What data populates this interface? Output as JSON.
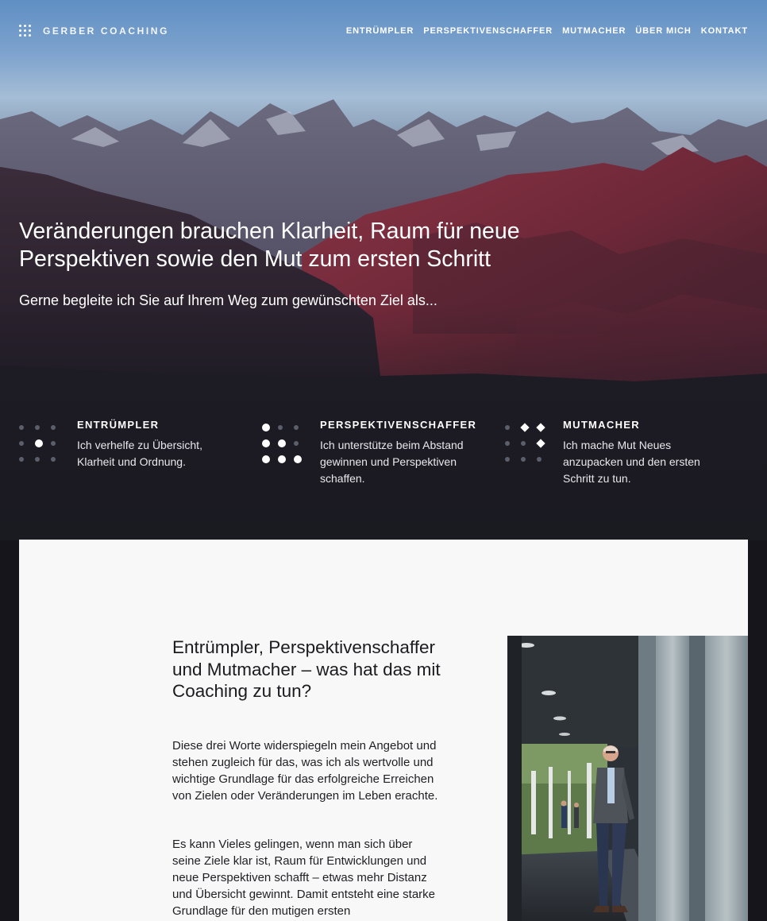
{
  "header": {
    "logo_text": "GERBER COACHING",
    "nav": [
      "ENTRÜMPLER",
      "PERSPEKTIVENSCHAFFER",
      "MUTMACHER",
      "ÜBER MICH",
      "KONTAKT"
    ]
  },
  "hero": {
    "title": "Veränderungen brauchen Klarheit, Raum für neue Perspektiven sowie den Mut zum ersten Schritt",
    "subtitle": "Gerne begleite ich Sie auf Ihrem Weg zum gewünschten Ziel als..."
  },
  "features": [
    {
      "title": "ENTRÜMPLER",
      "text": "Ich verhelfe zu Übersicht, Klarheit und Ordnung.",
      "icon": "dots-grid-center-icon"
    },
    {
      "title": "PERSPEKTIVENSCHAFFER",
      "text": "Ich unterstütze beim Abstand gewinnen und Perspektiven schaffen.",
      "icon": "dots-grid-staircase-icon"
    },
    {
      "title": "MUTMACHER",
      "text": "Ich mache Mut Neues anzupacken und den ersten Schritt zu tun.",
      "icon": "dots-grid-arrow-icon"
    }
  ],
  "content": {
    "heading": "Entrümpler, Perspektivenschaffer und Mutmacher – was hat das mit Coaching zu tun?",
    "paragraphs": [
      "Diese drei Worte widerspiegeln mein Angebot und stehen zugleich für das, was ich als wertvolle und wichtige Grundlage für das erfol­greiche Erreichen von Zielen oder Veränderungen im Leben erachte.",
      "Es kann Vieles gelingen, wenn man sich über seine Ziele klar ist, Raum für Entwicklungen und neue Perspektiven schafft – etwas mehr Distanz und Übersicht gewinnt. Damit entsteht eine starke Grundlage für den mutigen ersten"
    ],
    "image": "portrait-photo"
  },
  "colors": {
    "page_background": "#15151b",
    "card_background": "#f8f8f8",
    "text_dark": "#1b1b1f",
    "accent_red": "#9c2f45"
  }
}
